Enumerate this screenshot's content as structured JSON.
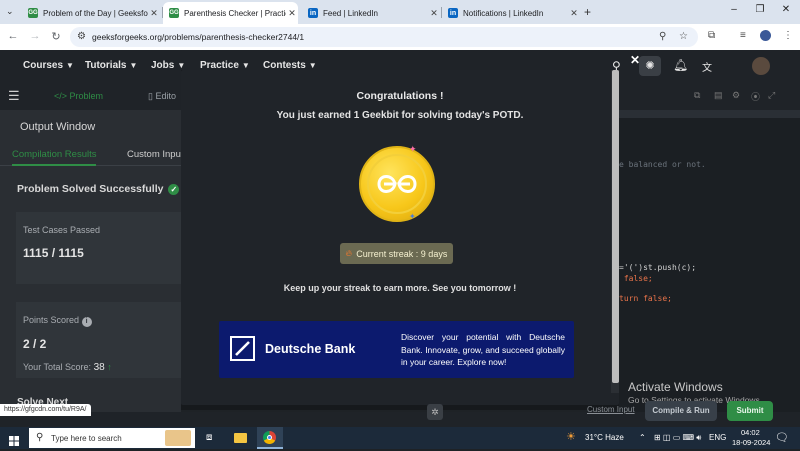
{
  "browser": {
    "tabs": [
      {
        "title": "Problem of the Day | GeeksforG",
        "favicon": "gfg-icon",
        "active": false
      },
      {
        "title": "Parenthesis Checker | Practice |",
        "favicon": "gfg-icon",
        "active": true
      },
      {
        "title": "Feed | LinkedIn",
        "favicon": "linkedin-icon",
        "active": false
      },
      {
        "title": "Notifications | LinkedIn",
        "favicon": "linkedin-icon",
        "active": false
      }
    ],
    "url": "geeksforgeeks.org/problems/parenthesis-checker2744/1",
    "status_url": "https://gfgcdn.com/tu/R9A/"
  },
  "site_nav": {
    "items": [
      "Courses",
      "Tutorials",
      "Jobs",
      "Practice",
      "Contests"
    ]
  },
  "left_panel": {
    "tabs": [
      "Problem",
      "Edito"
    ],
    "output_title": "Output Window",
    "subtabs": [
      "Compilation Results",
      "Custom Inpu"
    ],
    "status": "Problem Solved Successfully",
    "tests_label": "Test Cases Passed",
    "tests_value": "1115 / 1115",
    "points_label": "Points Scored",
    "points_value": "2 / 2",
    "total_label": "Your Total Score:",
    "total_value": "38",
    "solve_next": "Solve Next"
  },
  "modal": {
    "title": "Congratulations !",
    "subtitle": "You just earned 1 Geekbit for solving today's POTD.",
    "streak": "Current streak : 9 days",
    "keep": "Keep up your streak to earn more. See you tomorrow !",
    "ad_brand": "Deutsche Bank",
    "ad_text": "Discover your potential with Deutsche Bank. Innovate, grow, and succeed globally in your career. Explore now!"
  },
  "editor": {
    "lines": [
      {
        "text": "e balanced or not.",
        "color": "#6b737c"
      },
      {
        "text": "='(')st.push(c);",
        "color": "#d4d4d4"
      },
      {
        "text": " false;",
        "color": "#e8734a"
      },
      {
        "text": "turn false;",
        "color": "#e8734a"
      }
    ],
    "custom_input": "Custom Input",
    "compile_run": "Compile & Run",
    "submit": "Submit"
  },
  "activation": {
    "title": "Activate Windows",
    "sub": "Go to Settings to activate Windows."
  },
  "taskbar": {
    "search_placeholder": "Type here to search",
    "weather": "31°C  Haze",
    "lang": "ENG",
    "time": "04:02",
    "date": "18-09-2024"
  },
  "colors": {
    "accent_green": "#2f8d46",
    "coin_gold": "#f7c71a",
    "ad_blue": "#0c1a6e",
    "submit_green": "#2f8d46"
  }
}
